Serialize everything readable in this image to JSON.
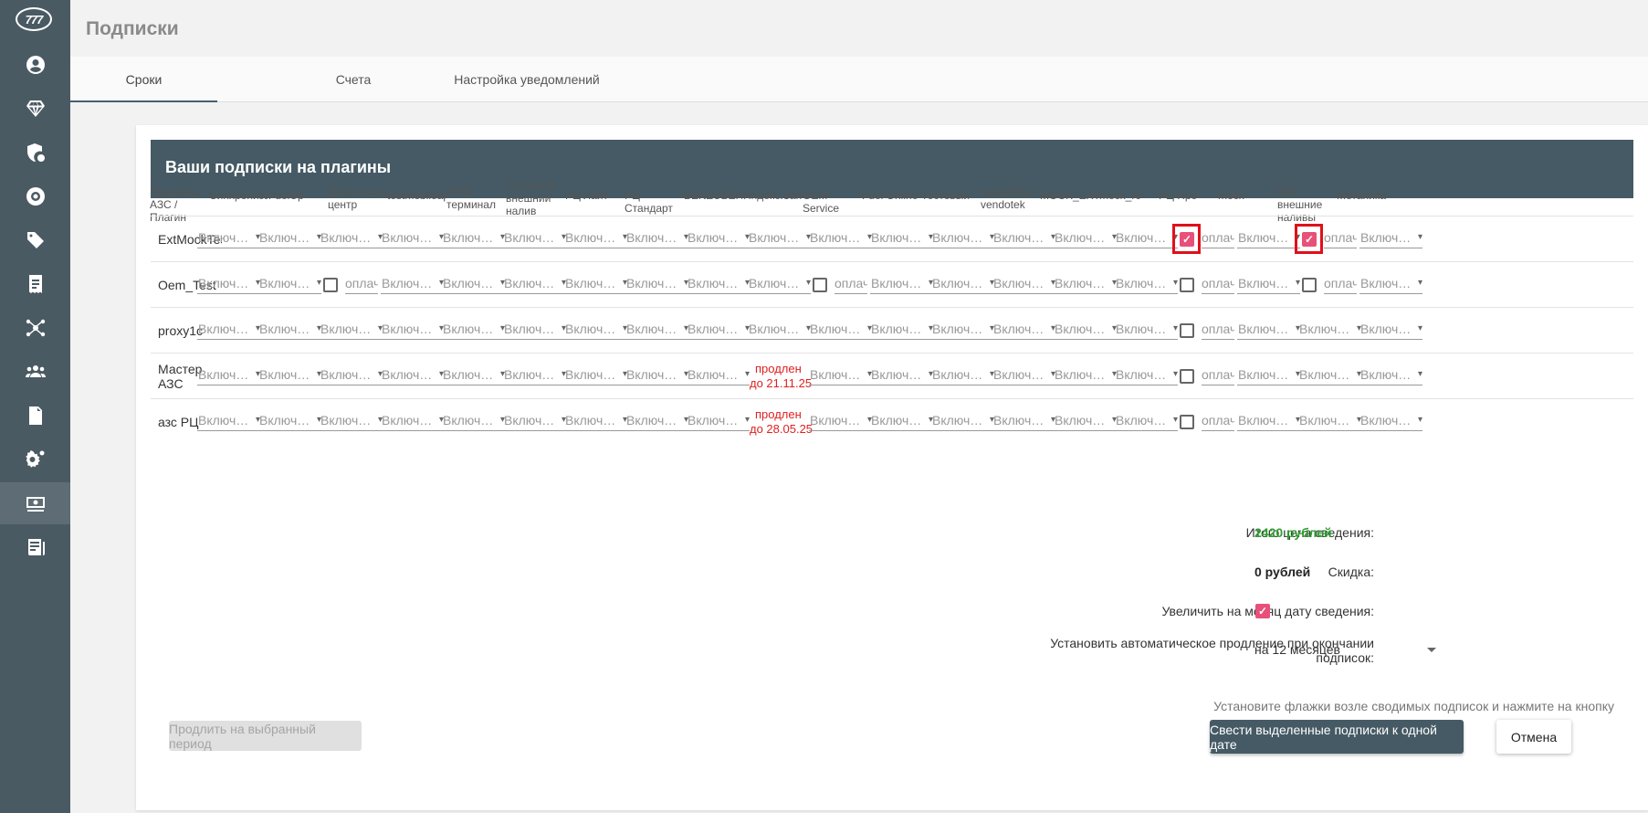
{
  "app": {
    "logo_text": "777",
    "page_title": "Подписки"
  },
  "sidebar": {
    "items": [
      {
        "icon": "user-circle-icon"
      },
      {
        "icon": "diamond-icon"
      },
      {
        "icon": "shield-gear-icon"
      },
      {
        "icon": "lifebuoy-icon"
      },
      {
        "icon": "tags-icon"
      },
      {
        "icon": "receipt-icon"
      },
      {
        "icon": "network-icon"
      },
      {
        "icon": "users-group-icon"
      },
      {
        "icon": "document-fuel-icon"
      },
      {
        "icon": "settings-gears-icon"
      },
      {
        "icon": "subscription-money-icon",
        "active": true
      },
      {
        "icon": "news-list-icon"
      }
    ]
  },
  "tabs": [
    {
      "label": "Сроки",
      "active": true
    },
    {
      "label": "Счета"
    },
    {
      "label": "Настройка уведомлений"
    }
  ],
  "card": {
    "title": "Ваши подписки на плагины"
  },
  "table": {
    "headers": [
      "Название АЗС / Плагин",
      "Синхронизация",
      "FuelUp",
      "Дисконтный центр",
      "testmobileapp",
      "POS-терминал",
      "Тестовый внешний налив",
      "РЦ Лайт",
      "РЦ Стандарт",
      "BENZUBER",
      "Яндекс.Заправки",
      "OEM-Service",
      "Fuel Online",
      "Тестовый",
      "nakolonke-vendotek",
      "MOCK_EXTERNAL",
      "mock_rc",
      "РЦ Про",
      "mock",
      "Мок внешние наливы",
      "Метаника"
    ],
    "select_placeholder": "Включить",
    "pay_placeholder": "оплачено",
    "rows": [
      {
        "name": "ExtMockTest"
      },
      {
        "name": "Oem_Test"
      },
      {
        "name": "proxy1c"
      },
      {
        "name": "Мастер АЗС",
        "ext_line1": "продлен",
        "ext_line2": "до 21.11.25"
      },
      {
        "name": "азс РЦ",
        "ext_line1": "продлен",
        "ext_line2": "до 28.05.25"
      }
    ]
  },
  "summary": {
    "total_label": "Итого цена сведения:",
    "total_value": "2420 рублей",
    "discount_label": "Скидка:",
    "discount_value": "0 рублей",
    "extend_label": "Увеличить на месяц дату сведения:",
    "auto_label_line1": "Установить автоматическое продление при окончании",
    "auto_label_line2": "подписок:",
    "auto_value": "на 12 месяцев",
    "hint": "Установите флажки возле сводимых подписок и нажмите на кнопку"
  },
  "buttons": {
    "extend": "Продлить на выбранный период",
    "merge": "Свести выделенные подписки к одной дате",
    "cancel": "Отмена"
  },
  "colors": {
    "sidebar": "#4a5a63",
    "header": "#455a64",
    "accent": "#e8507a",
    "total": "#2e9e2e",
    "extended": "#e02020"
  }
}
